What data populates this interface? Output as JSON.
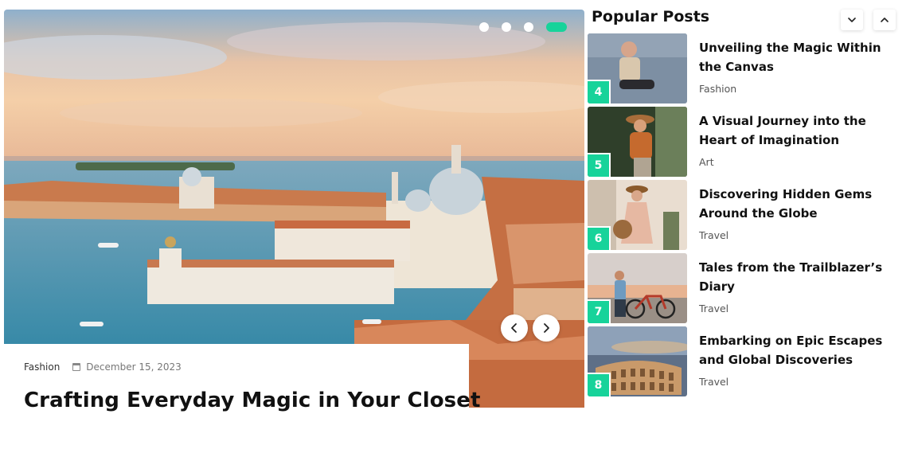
{
  "slider": {
    "dots": [
      false,
      false,
      false,
      true
    ],
    "accent_color": "#17d39a",
    "image": "venice-cityscape",
    "category": "Fashion",
    "date": "December 15, 2023",
    "title": "Crafting Everyday Magic in Your Closet"
  },
  "sidebar": {
    "title": "Popular Posts",
    "posts": [
      {
        "number": "4",
        "title": "Unveiling the Magic Within the Canvas",
        "category": "Fashion"
      },
      {
        "number": "5",
        "title": "A Visual Journey into the Heart of Imagination",
        "category": "Art"
      },
      {
        "number": "6",
        "title": "Discovering Hidden Gems Around the Globe",
        "category": "Travel"
      },
      {
        "number": "7",
        "title": "Tales from the Trailblazer’s Diary",
        "category": "Travel"
      },
      {
        "number": "8",
        "title": "Embarking on Epic Escapes and Global Discoveries",
        "category": "Travel"
      }
    ]
  }
}
